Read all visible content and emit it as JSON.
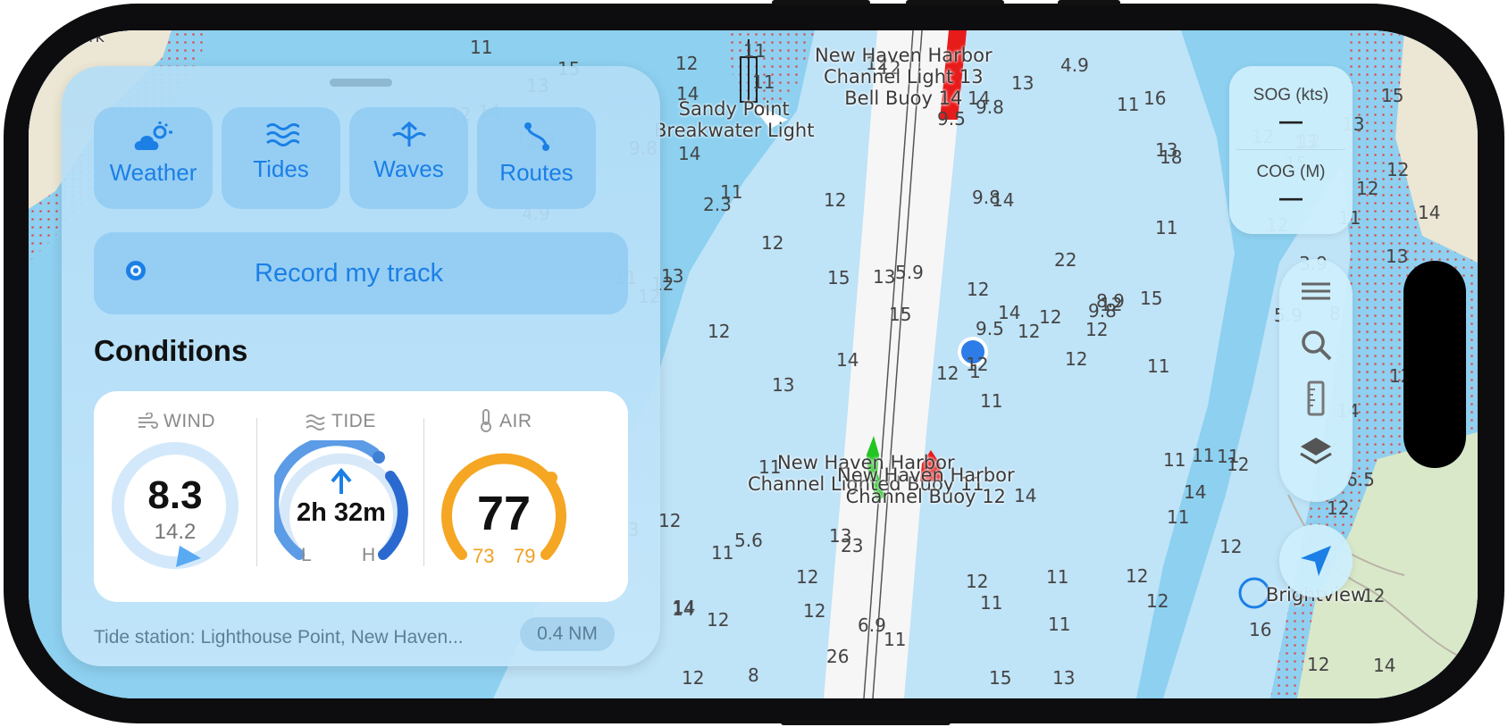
{
  "tools": [
    {
      "label": "Weather",
      "icon": "weather-icon"
    },
    {
      "label": "Tides",
      "icon": "tides-icon"
    },
    {
      "label": "Waves",
      "icon": "waves-icon"
    },
    {
      "label": "Routes",
      "icon": "routes-icon"
    }
  ],
  "record_label": "Record my track",
  "conditions": {
    "title": "Conditions",
    "wind": {
      "label": "WIND",
      "value": "8.3",
      "gust": "14.2"
    },
    "tide": {
      "label": "TIDE",
      "value": "2h 32m",
      "low": "L",
      "high": "H"
    },
    "air": {
      "label": "AIR",
      "value": "77",
      "low": "73",
      "high": "79"
    }
  },
  "tide_station": "Tide station: Lighthouse Point, New Haven...",
  "tide_station_distance": "0.4 NM",
  "instruments": {
    "sog_label": "SOG (kts)",
    "sog_value": "—",
    "cog_label": "COG (M)",
    "cog_value": "—"
  },
  "map_labels": {
    "sandy_point": "Sandy Point\nBreakwater Light",
    "buoy_13": "New Haven Harbor\nChannel Light 13\nBell Buoy 14",
    "buoy_11": "New Haven Harbor\nChannel Lighted Buoy 11",
    "buoy_12": "New Haven Harbor\nChannel Buoy 12",
    "brightview": "Brightview",
    "park": "se Park"
  },
  "depth_soundings": [
    "2.3",
    "2.3",
    "1",
    "14",
    "9.8",
    "23",
    "16",
    "13",
    "13",
    "12",
    "11",
    "14",
    "12",
    "12",
    "11",
    "11",
    "8",
    "9.8",
    "22",
    "5.6",
    "5.9",
    "5.9",
    "12",
    "14",
    "12",
    "12",
    "11",
    "9.8",
    "12",
    "11",
    "13",
    "12",
    "12",
    "9.5",
    "12",
    "15",
    "13",
    "12",
    "12",
    "11",
    "4.9",
    "13",
    "14",
    "11",
    "26",
    "11",
    "12",
    "12",
    "11",
    "12",
    "11",
    "11",
    "9.8",
    "14",
    "12",
    "12",
    "11",
    "12",
    "11",
    "13",
    "13",
    "14",
    "13",
    "12",
    "12",
    "11",
    "11",
    "9.5",
    "14",
    "13",
    "12",
    "11",
    "11",
    "15",
    "14",
    "14",
    "12",
    "12",
    "12",
    "11",
    "12",
    "12",
    "11",
    "6.5",
    "4.9",
    "8",
    "14",
    "16",
    "13",
    "12",
    "14",
    "14",
    "15",
    "12",
    "12",
    "12",
    "12",
    "15",
    "15",
    "18",
    "13",
    "12",
    "12",
    "12",
    "11",
    "3.9",
    "6.9",
    "8.9",
    "15",
    "15",
    "14",
    "14",
    "13",
    "12",
    "12",
    "12",
    "11"
  ],
  "accent": "#1b7fe6",
  "colors": {
    "land": "#ece6d4",
    "shallow": "#8dd0f0",
    "deep": "#bfe3f7",
    "channel": "#f8f8f8",
    "red_buoy": "#e81b1b",
    "green_buoy": "#22c522",
    "air_gauge": "#f5a623",
    "wind_gauge": "#1b7fe6",
    "tide_gauge": "#3f7fd6"
  }
}
